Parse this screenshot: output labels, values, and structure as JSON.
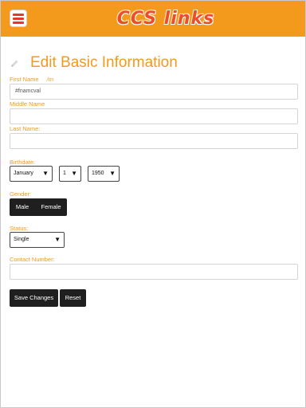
{
  "header": {
    "logo_text": "CCS links",
    "menu_icon": "hamburger-menu-icon",
    "background_color": "#f39a1d"
  },
  "page": {
    "title": "Edit Basic Information",
    "title_icon": "pencil-icon"
  },
  "form": {
    "first_name": {
      "label": "First Name",
      "hint": "/m",
      "value": "#fnamcval"
    },
    "middle_name": {
      "label": "Middle Name",
      "value": ""
    },
    "last_name": {
      "label": "Last Name:",
      "value": ""
    },
    "birthdate": {
      "label": "Birthdate:",
      "month": "January",
      "day": "1",
      "year": "1950"
    },
    "gender": {
      "label": "Gender:",
      "options": [
        "Male",
        "Female"
      ]
    },
    "status": {
      "label": "Status:",
      "value": "Single"
    },
    "contact_number": {
      "label": "Contact Number:",
      "value": ""
    },
    "buttons": {
      "save": "Save Changes",
      "reset": "Reset"
    }
  },
  "colors": {
    "accent": "#f39a1d",
    "logo": "#ef4d2a",
    "button": "#1f1f1f"
  }
}
